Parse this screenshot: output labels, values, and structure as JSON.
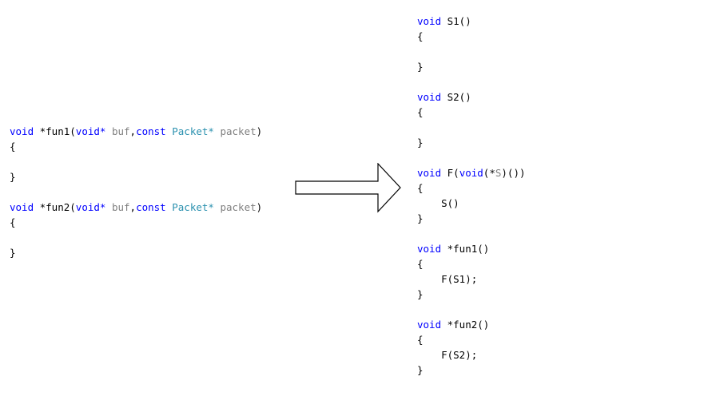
{
  "left_code": [
    [
      {
        "t": "void",
        "c": "kw"
      },
      {
        "t": " *fun1(",
        "c": "tx"
      },
      {
        "t": "void*",
        "c": "kw"
      },
      {
        "t": " buf",
        "c": "id"
      },
      {
        "t": ",",
        "c": "tx"
      },
      {
        "t": "const",
        "c": "kw"
      },
      {
        "t": " ",
        "c": "tx"
      },
      {
        "t": "Packet*",
        "c": "ty"
      },
      {
        "t": " packet",
        "c": "id"
      },
      {
        "t": ")",
        "c": "tx"
      }
    ],
    [
      {
        "t": "{",
        "c": "tx"
      }
    ],
    [],
    [
      {
        "t": "}",
        "c": "tx"
      }
    ],
    [],
    [
      {
        "t": "void",
        "c": "kw"
      },
      {
        "t": " *fun2(",
        "c": "tx"
      },
      {
        "t": "void*",
        "c": "kw"
      },
      {
        "t": " buf",
        "c": "id"
      },
      {
        "t": ",",
        "c": "tx"
      },
      {
        "t": "const",
        "c": "kw"
      },
      {
        "t": " ",
        "c": "tx"
      },
      {
        "t": "Packet*",
        "c": "ty"
      },
      {
        "t": " packet",
        "c": "id"
      },
      {
        "t": ")",
        "c": "tx"
      }
    ],
    [
      {
        "t": "{",
        "c": "tx"
      }
    ],
    [],
    [
      {
        "t": "}",
        "c": "tx"
      }
    ]
  ],
  "right_code": [
    [
      {
        "t": "void",
        "c": "kw"
      },
      {
        "t": " S1()",
        "c": "tx"
      }
    ],
    [
      {
        "t": "{",
        "c": "tx"
      }
    ],
    [],
    [
      {
        "t": "}",
        "c": "tx"
      }
    ],
    [],
    [
      {
        "t": "void",
        "c": "kw"
      },
      {
        "t": " S2()",
        "c": "tx"
      }
    ],
    [
      {
        "t": "{",
        "c": "tx"
      }
    ],
    [],
    [
      {
        "t": "}",
        "c": "tx"
      }
    ],
    [],
    [
      {
        "t": "void",
        "c": "kw"
      },
      {
        "t": " F(",
        "c": "tx"
      },
      {
        "t": "void",
        "c": "kw"
      },
      {
        "t": "(*",
        "c": "tx"
      },
      {
        "t": "S",
        "c": "id"
      },
      {
        "t": ")())",
        "c": "tx"
      }
    ],
    [
      {
        "t": "{",
        "c": "tx"
      }
    ],
    [
      {
        "t": "    S()",
        "c": "tx"
      }
    ],
    [
      {
        "t": "}",
        "c": "tx"
      }
    ],
    [],
    [
      {
        "t": "void",
        "c": "kw"
      },
      {
        "t": " *fun1()",
        "c": "tx"
      }
    ],
    [
      {
        "t": "{",
        "c": "tx"
      }
    ],
    [
      {
        "t": "    F(S1);",
        "c": "tx"
      }
    ],
    [
      {
        "t": "}",
        "c": "tx"
      }
    ],
    [],
    [
      {
        "t": "void",
        "c": "kw"
      },
      {
        "t": " *fun2()",
        "c": "tx"
      }
    ],
    [
      {
        "t": "{",
        "c": "tx"
      }
    ],
    [
      {
        "t": "    F(S2);",
        "c": "tx"
      }
    ],
    [
      {
        "t": "}",
        "c": "tx"
      }
    ]
  ],
  "colors": {
    "keyword": "#0000ff",
    "type": "#2b91af",
    "identifier": "#808080",
    "text": "#000000",
    "arrow_stroke": "#000000",
    "arrow_fill": "#ffffff"
  },
  "arrow_direction": "right"
}
